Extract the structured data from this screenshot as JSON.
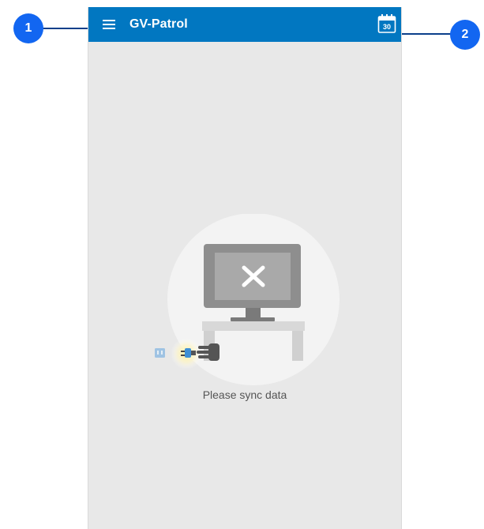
{
  "app_bar": {
    "title": "GV-Patrol",
    "menu_icon": "hamburger-menu-icon",
    "calendar_icon": "calendar-icon",
    "calendar_day": "30",
    "color": "#0177c1"
  },
  "main": {
    "illustration_icon": "disconnected-monitor-icon",
    "message": "Please sync data",
    "background": "#e8e8e8"
  },
  "callouts": [
    {
      "label": "1"
    },
    {
      "label": "2"
    }
  ],
  "colors": {
    "badge": "#1266f1",
    "callout_line": "#0b3f8a"
  }
}
